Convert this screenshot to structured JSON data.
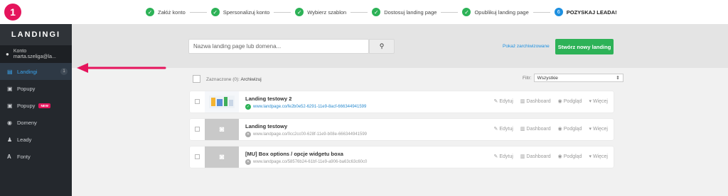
{
  "tutorial_step": "1",
  "progress": {
    "steps": [
      {
        "label": "Załóż konto",
        "state": "done"
      },
      {
        "label": "Spersonalizuj konto",
        "state": "done"
      },
      {
        "label": "Wybierz szablon",
        "state": "done"
      },
      {
        "label": "Dostosuj landing page",
        "state": "done"
      },
      {
        "label": "Opublikuj landing page",
        "state": "done"
      },
      {
        "label": "POZYSKAJ LEADA!",
        "state": "active",
        "number": "6"
      }
    ]
  },
  "sidebar": {
    "logo": "LANDINGI",
    "account": {
      "line1": "Konto",
      "line2": "marta.szeliga@la..."
    },
    "items": [
      {
        "label": "Landingi",
        "icon": "landing-icon",
        "count": "1",
        "active": true
      },
      {
        "label": "Popupy",
        "icon": "popup-icon"
      },
      {
        "label": "Popupy",
        "icon": "popup-new-icon",
        "badge": "NEW"
      },
      {
        "label": "Domeny",
        "icon": "globe-icon"
      },
      {
        "label": "Leady",
        "icon": "user-icon"
      },
      {
        "label": "Fonty",
        "icon": "font-icon"
      }
    ]
  },
  "main": {
    "search_placeholder": "Nazwa landing page lub domena...",
    "archived_link": "Pokaż zarchiwizowane",
    "create_button": "Stwórz nowy landing",
    "selected_label": "Zaznaczone",
    "selected_count": "(0):",
    "archive_action": "Archiwizuj",
    "filter_label": "Filtr:",
    "filter_value": "Wszystkie",
    "actions": {
      "edit": "Edytuj",
      "dashboard": "Dashboard",
      "preview": "Podgląd",
      "more": "Więcej"
    },
    "landings": [
      {
        "title": "Landing testowy 2",
        "url": "www.landpage.co/fe2b0e52-6291-11e9-8acf-666344941599",
        "published": true
      },
      {
        "title": "Landing testowy",
        "url": "www.landpage.co/0cc2cc00-628f-11e9-b08e-666344941599",
        "published": false
      },
      {
        "title": "[MU] Box options / opcje widgetu boxa",
        "url": "www.landpage.co/58576b24-61bf-11e9-a906-ba63c63c60c0",
        "published": false
      }
    ]
  },
  "colors": {
    "accent": "#e5145c",
    "success": "#2db257",
    "link": "#1c8fe0",
    "sidebar": "#24282d"
  }
}
